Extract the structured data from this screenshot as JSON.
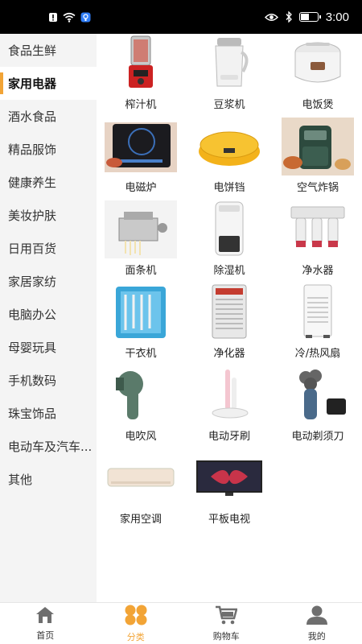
{
  "status_bar": {
    "time": "3:00",
    "battery_level": 0.5,
    "icons": [
      "notification-icon",
      "wifi-icon",
      "hotspot-icon",
      "eye-icon",
      "bluetooth-icon",
      "battery-icon"
    ]
  },
  "sidebar": {
    "active_index": 1,
    "accent_color": "#f2a436",
    "items": [
      {
        "label": "食品生鲜"
      },
      {
        "label": "家用电器"
      },
      {
        "label": "酒水食品"
      },
      {
        "label": "精品服饰"
      },
      {
        "label": "健康养生"
      },
      {
        "label": "美妆护肤"
      },
      {
        "label": "日用百货"
      },
      {
        "label": "家居家纺"
      },
      {
        "label": "电脑办公"
      },
      {
        "label": "母婴玩具"
      },
      {
        "label": "手机数码"
      },
      {
        "label": "珠宝饰品"
      },
      {
        "label": "电动车及汽车..."
      },
      {
        "label": "其他"
      }
    ]
  },
  "products": [
    {
      "label": "榨汁机",
      "icon": "juicer-icon"
    },
    {
      "label": "豆浆机",
      "icon": "soymilk-maker-icon"
    },
    {
      "label": "电饭煲",
      "icon": "rice-cooker-icon"
    },
    {
      "label": "电磁炉",
      "icon": "induction-cooker-icon"
    },
    {
      "label": "电饼铛",
      "icon": "electric-griddle-icon"
    },
    {
      "label": "空气炸锅",
      "icon": "air-fryer-icon"
    },
    {
      "label": "面条机",
      "icon": "noodle-maker-icon"
    },
    {
      "label": "除湿机",
      "icon": "dehumidifier-icon"
    },
    {
      "label": "净水器",
      "icon": "water-purifier-icon"
    },
    {
      "label": "干衣机",
      "icon": "clothes-dryer-icon"
    },
    {
      "label": "净化器",
      "icon": "air-purifier-icon"
    },
    {
      "label": "冷/热风扇",
      "icon": "fan-icon"
    },
    {
      "label": "电吹风",
      "icon": "hair-dryer-icon"
    },
    {
      "label": "电动牙刷",
      "icon": "toothbrush-icon"
    },
    {
      "label": "电动剃须刀",
      "icon": "shaver-icon"
    },
    {
      "label": "家用空调",
      "icon": "air-conditioner-icon"
    },
    {
      "label": "平板电视",
      "icon": "tv-icon"
    }
  ],
  "tabbar": {
    "active_index": 1,
    "tabs": [
      {
        "label": "首页",
        "icon": "home-icon"
      },
      {
        "label": "分类",
        "icon": "category-icon"
      },
      {
        "label": "购物车",
        "icon": "cart-icon"
      },
      {
        "label": "我的",
        "icon": "profile-icon"
      }
    ]
  }
}
